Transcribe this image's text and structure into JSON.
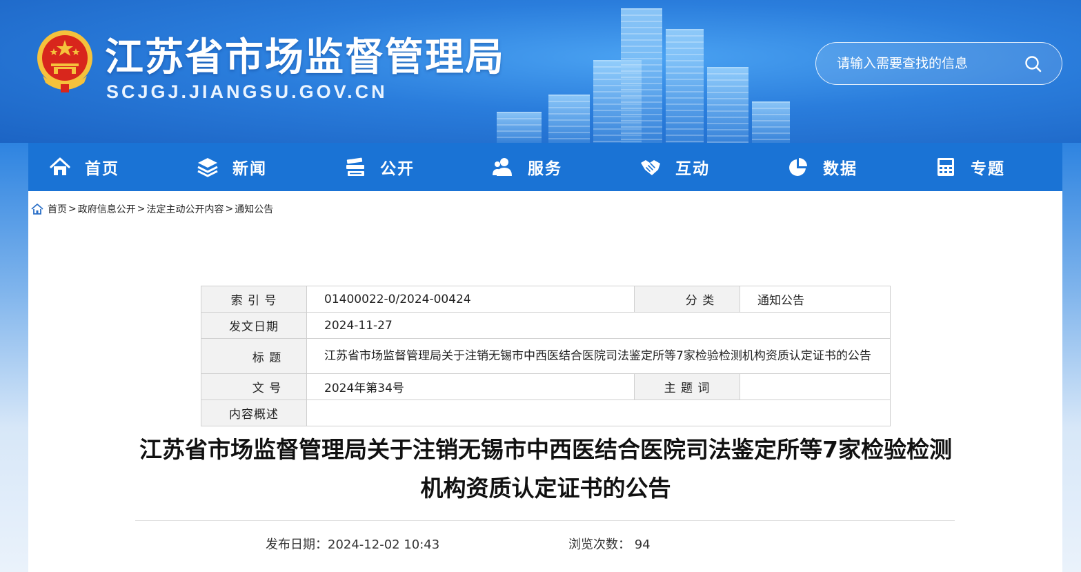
{
  "site": {
    "title": "江苏省市场监督管理局",
    "url": "SCJGJ.JIANGSU.GOV.CN"
  },
  "search": {
    "placeholder": "请输入需要查找的信息",
    "icon": "search-icon"
  },
  "nav": [
    {
      "label": "首页",
      "icon": "home-icon"
    },
    {
      "label": "新闻",
      "icon": "layers-icon"
    },
    {
      "label": "公开",
      "icon": "books-icon"
    },
    {
      "label": "服务",
      "icon": "users-icon"
    },
    {
      "label": "互动",
      "icon": "handshake-icon"
    },
    {
      "label": "数据",
      "icon": "pie-chart-icon"
    },
    {
      "label": "专题",
      "icon": "calculator-icon"
    }
  ],
  "breadcrumb": {
    "icon": "home-icon",
    "items": [
      "首页",
      "政府信息公开",
      "法定主动公开内容",
      "通知公告"
    ],
    "separator": ">"
  },
  "meta": {
    "index_label": "索 引 号",
    "index_value": "01400022-0/2024-00424",
    "category_label": "分 类",
    "category_value": "通知公告",
    "date_label": "发文日期",
    "date_value": "2024-11-27",
    "title_label": "标 题",
    "title_value": "江苏省市场监督管理局关于注销无锡市中西医结合医院司法鉴定所等7家检验检测机构资质认定证书的公告",
    "doc_no_label": "文 号",
    "doc_no_value": "2024年第34号",
    "keywords_label": "主 题 词",
    "keywords_value": "",
    "summary_label": "内容概述",
    "summary_value": ""
  },
  "article": {
    "title": "江苏省市场监督管理局关于注销无锡市中西医结合医院司法鉴定所等7家检验检测机构资质认定证书的公告",
    "publish_label": "发布日期：",
    "publish_value": "2024-12-02 10:43",
    "views_label": "浏览次数：",
    "views_value": "94"
  },
  "colors": {
    "nav_bg": "#1a73d5",
    "header_bg": "#2a7ddc",
    "emblem_red": "#d8261c",
    "emblem_gold": "#f5c23c"
  }
}
